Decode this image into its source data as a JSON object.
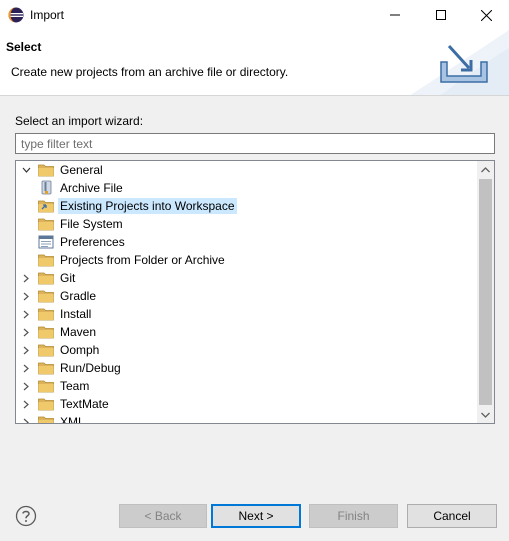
{
  "window": {
    "title": "Import",
    "icon": "eclipse-icon"
  },
  "banner": {
    "heading": "Select",
    "description": "Create new projects from an archive file or directory.",
    "graphic": "import-graphic"
  },
  "wizard": {
    "label": "Select an import wizard:",
    "filter_placeholder": "type filter text",
    "filter_value": ""
  },
  "tree": {
    "items": [
      {
        "label": "General",
        "level": 0,
        "expanded": true,
        "icon": "folder-icon"
      },
      {
        "label": "Archive File",
        "level": 1,
        "icon": "archive-icon"
      },
      {
        "label": "Existing Projects into Workspace",
        "level": 1,
        "icon": "project-import-icon",
        "selected": true
      },
      {
        "label": "File System",
        "level": 1,
        "icon": "file-system-folder-icon"
      },
      {
        "label": "Preferences",
        "level": 1,
        "icon": "preferences-icon"
      },
      {
        "label": "Projects from Folder or Archive",
        "level": 1,
        "icon": "folder-icon"
      },
      {
        "label": "Git",
        "level": 0,
        "expanded": false,
        "icon": "folder-icon"
      },
      {
        "label": "Gradle",
        "level": 0,
        "expanded": false,
        "icon": "folder-icon"
      },
      {
        "label": "Install",
        "level": 0,
        "expanded": false,
        "icon": "folder-icon"
      },
      {
        "label": "Maven",
        "level": 0,
        "expanded": false,
        "icon": "folder-icon"
      },
      {
        "label": "Oomph",
        "level": 0,
        "expanded": false,
        "icon": "folder-icon"
      },
      {
        "label": "Run/Debug",
        "level": 0,
        "expanded": false,
        "icon": "folder-icon"
      },
      {
        "label": "Team",
        "level": 0,
        "expanded": false,
        "icon": "folder-icon"
      },
      {
        "label": "TextMate",
        "level": 0,
        "expanded": false,
        "icon": "folder-icon"
      },
      {
        "label": "XML",
        "level": 0,
        "expanded": false,
        "icon": "folder-icon"
      }
    ]
  },
  "buttons": {
    "back": "< Back",
    "next": "Next >",
    "finish": "Finish",
    "cancel": "Cancel"
  },
  "colors": {
    "selection": "#cce8ff",
    "folder": "#dcb35c",
    "accent": "#0078d7"
  }
}
